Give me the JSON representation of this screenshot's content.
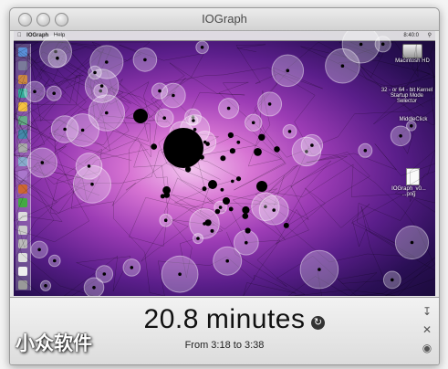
{
  "window": {
    "title": "IOGraph"
  },
  "desktop": {
    "menubar": {
      "app_name": "IOGraph",
      "menu_help": "Help",
      "clock": "8:40:0"
    },
    "icons": {
      "hd_label": "Macintosh HD",
      "kernel_label": "32 - or 64 - bit Kernel Startup Mode Selector",
      "middle_label": "MiddleClick",
      "screenshot_label": "IOGraph_v0... ...png"
    }
  },
  "stats": {
    "duration_value": "20.8",
    "duration_unit": "minutes",
    "time_range": "From 3:18 to 3:38"
  },
  "watermark": "小众软件",
  "icons": {
    "reset": "reset-icon",
    "save": "download-icon",
    "settings": "tools-icon",
    "web": "globe-icon"
  },
  "colors": {
    "dot": "#000000",
    "circle_fill": "#ffffff",
    "line": "#000000"
  }
}
